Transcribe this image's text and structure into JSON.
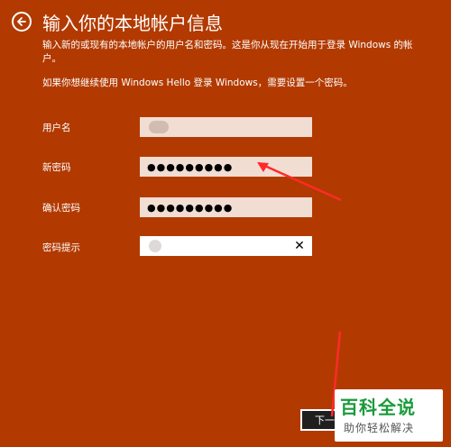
{
  "colors": {
    "background": "#b23a00",
    "field_bg": "#f2ddd3",
    "arrow": "#ff2a2a",
    "watermark_green": "#1a9a3a"
  },
  "header": {
    "back_icon": "back-arrow-circle-icon",
    "title": "输入你的本地帐户信息",
    "subtitle": "输入新的或现有的本地帐户的用户名和密码。这是你从现在开始用于登录 Windows 的帐户。"
  },
  "hello_note": "如果你想继续使用 Windows Hello 登录 Windows，需要设置一个密码。",
  "form": {
    "username_label": "用户名",
    "new_password_label": "新密码",
    "new_password_value": "●●●●●●●●●",
    "confirm_password_label": "确认密码",
    "confirm_password_value": "●●●●●●●●●",
    "hint_label": "密码提示",
    "clear_icon": "close-icon",
    "clear_glyph": "✕"
  },
  "footer": {
    "next_label": "下一"
  },
  "watermark": {
    "main": "百科全说",
    "sub": "助你轻松解决"
  }
}
